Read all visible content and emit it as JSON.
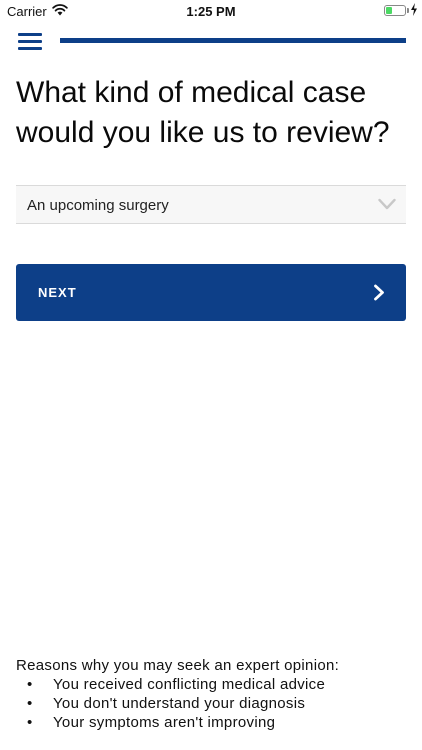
{
  "status_bar": {
    "carrier": "Carrier",
    "time": "1:25 PM",
    "battery_level": 0.4,
    "battery_color": "#4cd964"
  },
  "header": {
    "menu_icon": "hamburger-menu-icon",
    "progress_fraction": 1.0,
    "accent_color": "#0d3f88"
  },
  "page": {
    "title": "What kind of medical case would you like us to review?"
  },
  "case_type_select": {
    "selected_value": "An upcoming surgery",
    "icon": "chevron-down-icon"
  },
  "next_button": {
    "label": "NEXT",
    "icon": "chevron-right-icon"
  },
  "reasons": {
    "intro": "Reasons why you may seek an expert opinion:",
    "bullet": "•",
    "items": [
      "You received conflicting medical advice",
      "You don't understand your diagnosis",
      "Your symptoms aren't improving"
    ]
  }
}
